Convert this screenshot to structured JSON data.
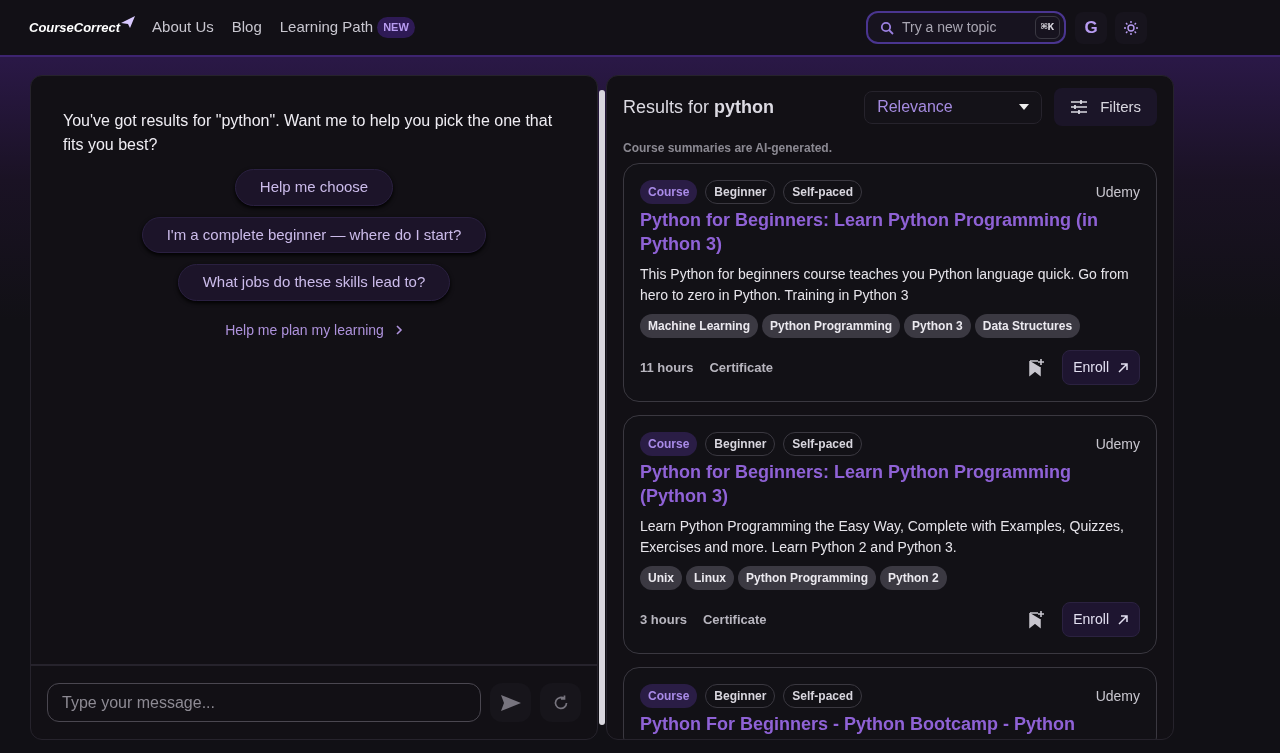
{
  "header": {
    "logo": "CourseCorrect",
    "nav": [
      {
        "label": "About Us"
      },
      {
        "label": "Blog"
      },
      {
        "label": "Learning Path",
        "badge": "NEW"
      }
    ],
    "search": {
      "placeholder": "Try a new topic",
      "shortcut": "⌘K"
    },
    "account_initial": "G"
  },
  "chat": {
    "message": "You've got results for \"python\". Want me to help you pick the one that fits you best?",
    "suggestions": [
      "Help me choose",
      "I'm a complete beginner — where do I start?",
      "What jobs do these skills lead to?"
    ],
    "plan_link": "Help me plan my learning",
    "input": {
      "placeholder": "Type your message..."
    }
  },
  "results": {
    "title": "Results for **python**",
    "sort": "Relevance",
    "filters": "Filters",
    "note": "Course summaries are AI-generated.",
    "courses": [
      {
        "type": "Course",
        "chips": [
          "Beginner",
          "Self-paced"
        ],
        "provider": "Udemy",
        "title": "Python for Beginners: Learn Python Programming (in Python 3)",
        "description": "This Python for beginners course teaches you Python language quick. Go from hero to zero in Python. Training in Python 3",
        "tags": [
          "Machine Learning",
          "Python Programming",
          "Python 3",
          "Data Structures"
        ],
        "duration": "11 hours",
        "credential": "Certificate",
        "enroll": "Enroll"
      },
      {
        "type": "Course",
        "chips": [
          "Beginner",
          "Self-paced"
        ],
        "provider": "Udemy",
        "title": "Python for Beginners: Learn Python Programming (Python 3)",
        "description": "Learn Python Programming the Easy Way, Complete with Examples, Quizzes, Exercises and more. Learn Python 2 and Python 3.",
        "tags": [
          "Unix",
          "Linux",
          "Python Programming",
          "Python 2"
        ],
        "duration": "3 hours",
        "credential": "Certificate",
        "enroll": "Enroll"
      },
      {
        "type": "Course",
        "chips": [
          "Beginner",
          "Self-paced"
        ],
        "provider": "Udemy",
        "title": "Python For Beginners - Python Bootcamp - Python"
      }
    ]
  }
}
